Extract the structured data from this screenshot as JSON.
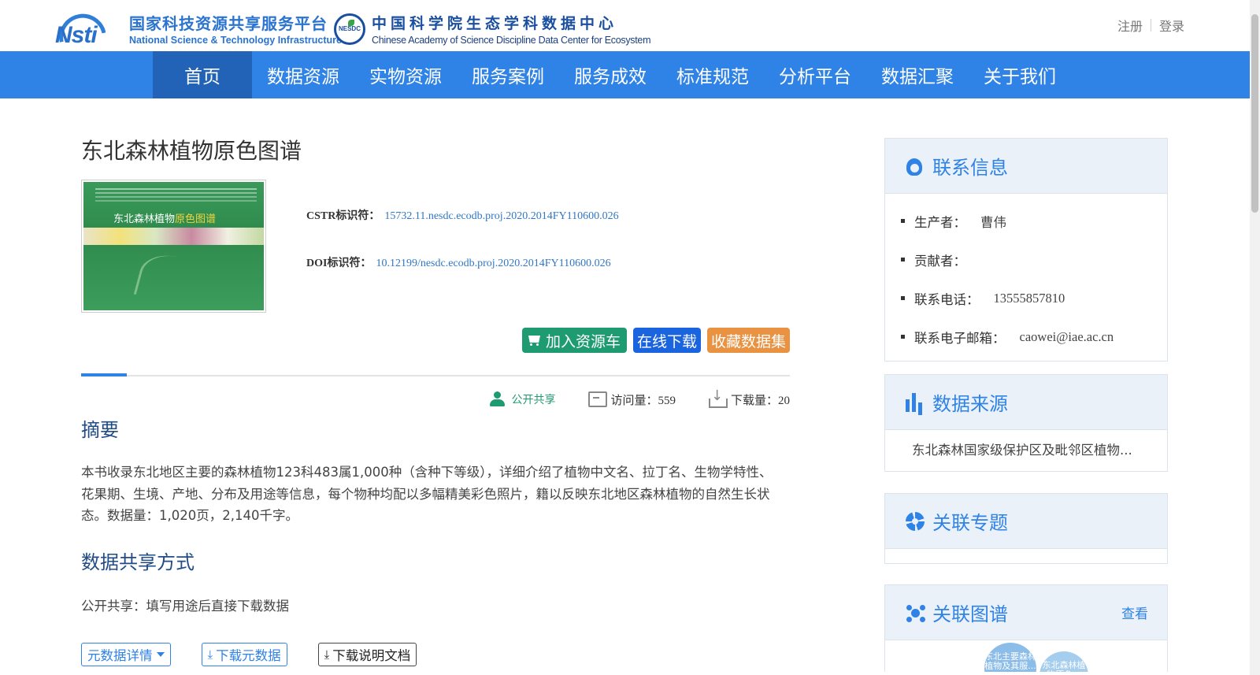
{
  "header": {
    "logo_cstr": {
      "cn": "国家科技资源共享服务平台",
      "en": "National Science & Technology Infrastructure",
      "mark": "Nsti"
    },
    "logo_nesdc": {
      "cn": "中国科学院生态学科数据中心",
      "en": "Chinese Academy of Science Discipline Data Center for Ecosystem",
      "badge": "NESDC"
    },
    "auth": {
      "register": "注册",
      "login": "登录"
    }
  },
  "nav": {
    "items": [
      "首页",
      "数据资源",
      "实物资源",
      "服务案例",
      "服务成效",
      "标准规范",
      "分析平台",
      "数据汇聚",
      "关于我们"
    ],
    "active_index": 0
  },
  "dataset": {
    "title": "东北森林植物原色图谱",
    "cover": {
      "title_a": "东北森林植物",
      "title_b": "原色图谱"
    },
    "cstr_label": "CSTR标识符：",
    "cstr_value": "15732.11.nesdc.ecodb.proj.2020.2014FY110600.026",
    "doi_label": "DOI标识符：",
    "doi_value": "10.12199/nesdc.ecodb.proj.2020.2014FY110600.026",
    "actions": {
      "cart": "加入资源车",
      "download": "在线下载",
      "favorite": "收藏数据集"
    },
    "stats": {
      "share": "公开共享",
      "views": "访问量：559",
      "downloads": "下载量：20"
    },
    "abstract_heading": "摘要",
    "abstract": "本书收录东北地区主要的森林植物123科483属1,000种（含种下等级），详细介绍了植物中文名、拉丁名、生物学特性、花果期、生境、产地、分布及用途等信息，每个物种均配以多幅精美彩色照片，籍以反映东北地区森林植物的自然生长状态。数据量：1,020页，2,140千字。",
    "share_heading": "数据共享方式",
    "share_text": "公开共享：填写用途后直接下载数据",
    "bottom_buttons": {
      "metadata": "元数据详情",
      "download_meta": "下载元数据",
      "download_doc": "下载说明文档"
    }
  },
  "sidebar": {
    "contact": {
      "title": "联系信息",
      "producer_label": "生产者：",
      "producer": "曹伟",
      "contributor_label": "贡献者：",
      "contributor": "",
      "phone_label": "联系电话：",
      "phone": "13555857810",
      "email_label": "联系电子邮箱：",
      "email": "caowei@iae.ac.cn"
    },
    "source": {
      "title": "数据来源",
      "text": "东北森林国家级保护区及毗邻区植物..."
    },
    "topic": {
      "title": "关联专题"
    },
    "graph": {
      "title": "关联图谱",
      "view": "查看",
      "nodes": [
        "东北主要森林植物及其服...",
        "东北森林植物原色..."
      ]
    }
  },
  "colors": {
    "nav": "#2f82e6",
    "nav_active": "#2263b8",
    "green": "#1f9b72",
    "blue": "#1a64e0",
    "orange": "#e89242",
    "link": "#3177c4"
  }
}
